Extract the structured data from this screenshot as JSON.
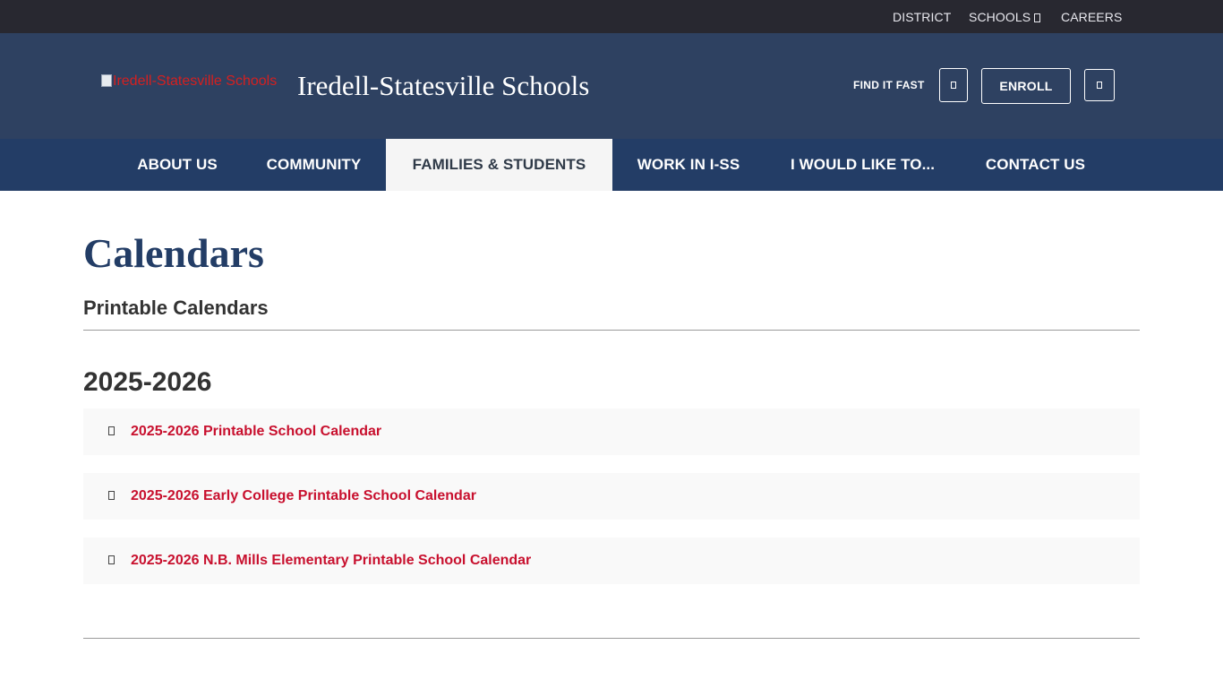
{
  "utility_nav": {
    "district": "DISTRICT",
    "schools": "SCHOOLS",
    "careers": "CAREERS"
  },
  "header": {
    "logo_alt": "Iredell-Statesville Schools",
    "site_title": "Iredell-Statesville Schools",
    "find_it_fast": "FIND IT FAST",
    "enroll": "ENROLL"
  },
  "main_nav": {
    "items": [
      {
        "label": "ABOUT US"
      },
      {
        "label": "COMMUNITY"
      },
      {
        "label": "FAMILIES & STUDENTS"
      },
      {
        "label": "WORK IN I-SS"
      },
      {
        "label": "I WOULD LIKE TO..."
      },
      {
        "label": "CONTACT US"
      }
    ],
    "active": "FAMILIES & STUDENTS"
  },
  "content": {
    "page_title": "Calendars",
    "section_heading": "Printable Calendars",
    "year_heading": "2025-2026",
    "calendars": [
      {
        "label": "2025-2026 Printable School Calendar"
      },
      {
        "label": "2025-2026 Early College Printable School Calendar"
      },
      {
        "label": "2025-2026 N.B. Mills Elementary Printable School Calendar"
      }
    ]
  },
  "colors": {
    "utility_bar_bg": "#282830",
    "header_bg": "#2e4161",
    "nav_bg": "#233d66",
    "active_nav_bg": "#f5f5f5",
    "link_red": "#c8102e",
    "title_blue": "#233d66"
  }
}
